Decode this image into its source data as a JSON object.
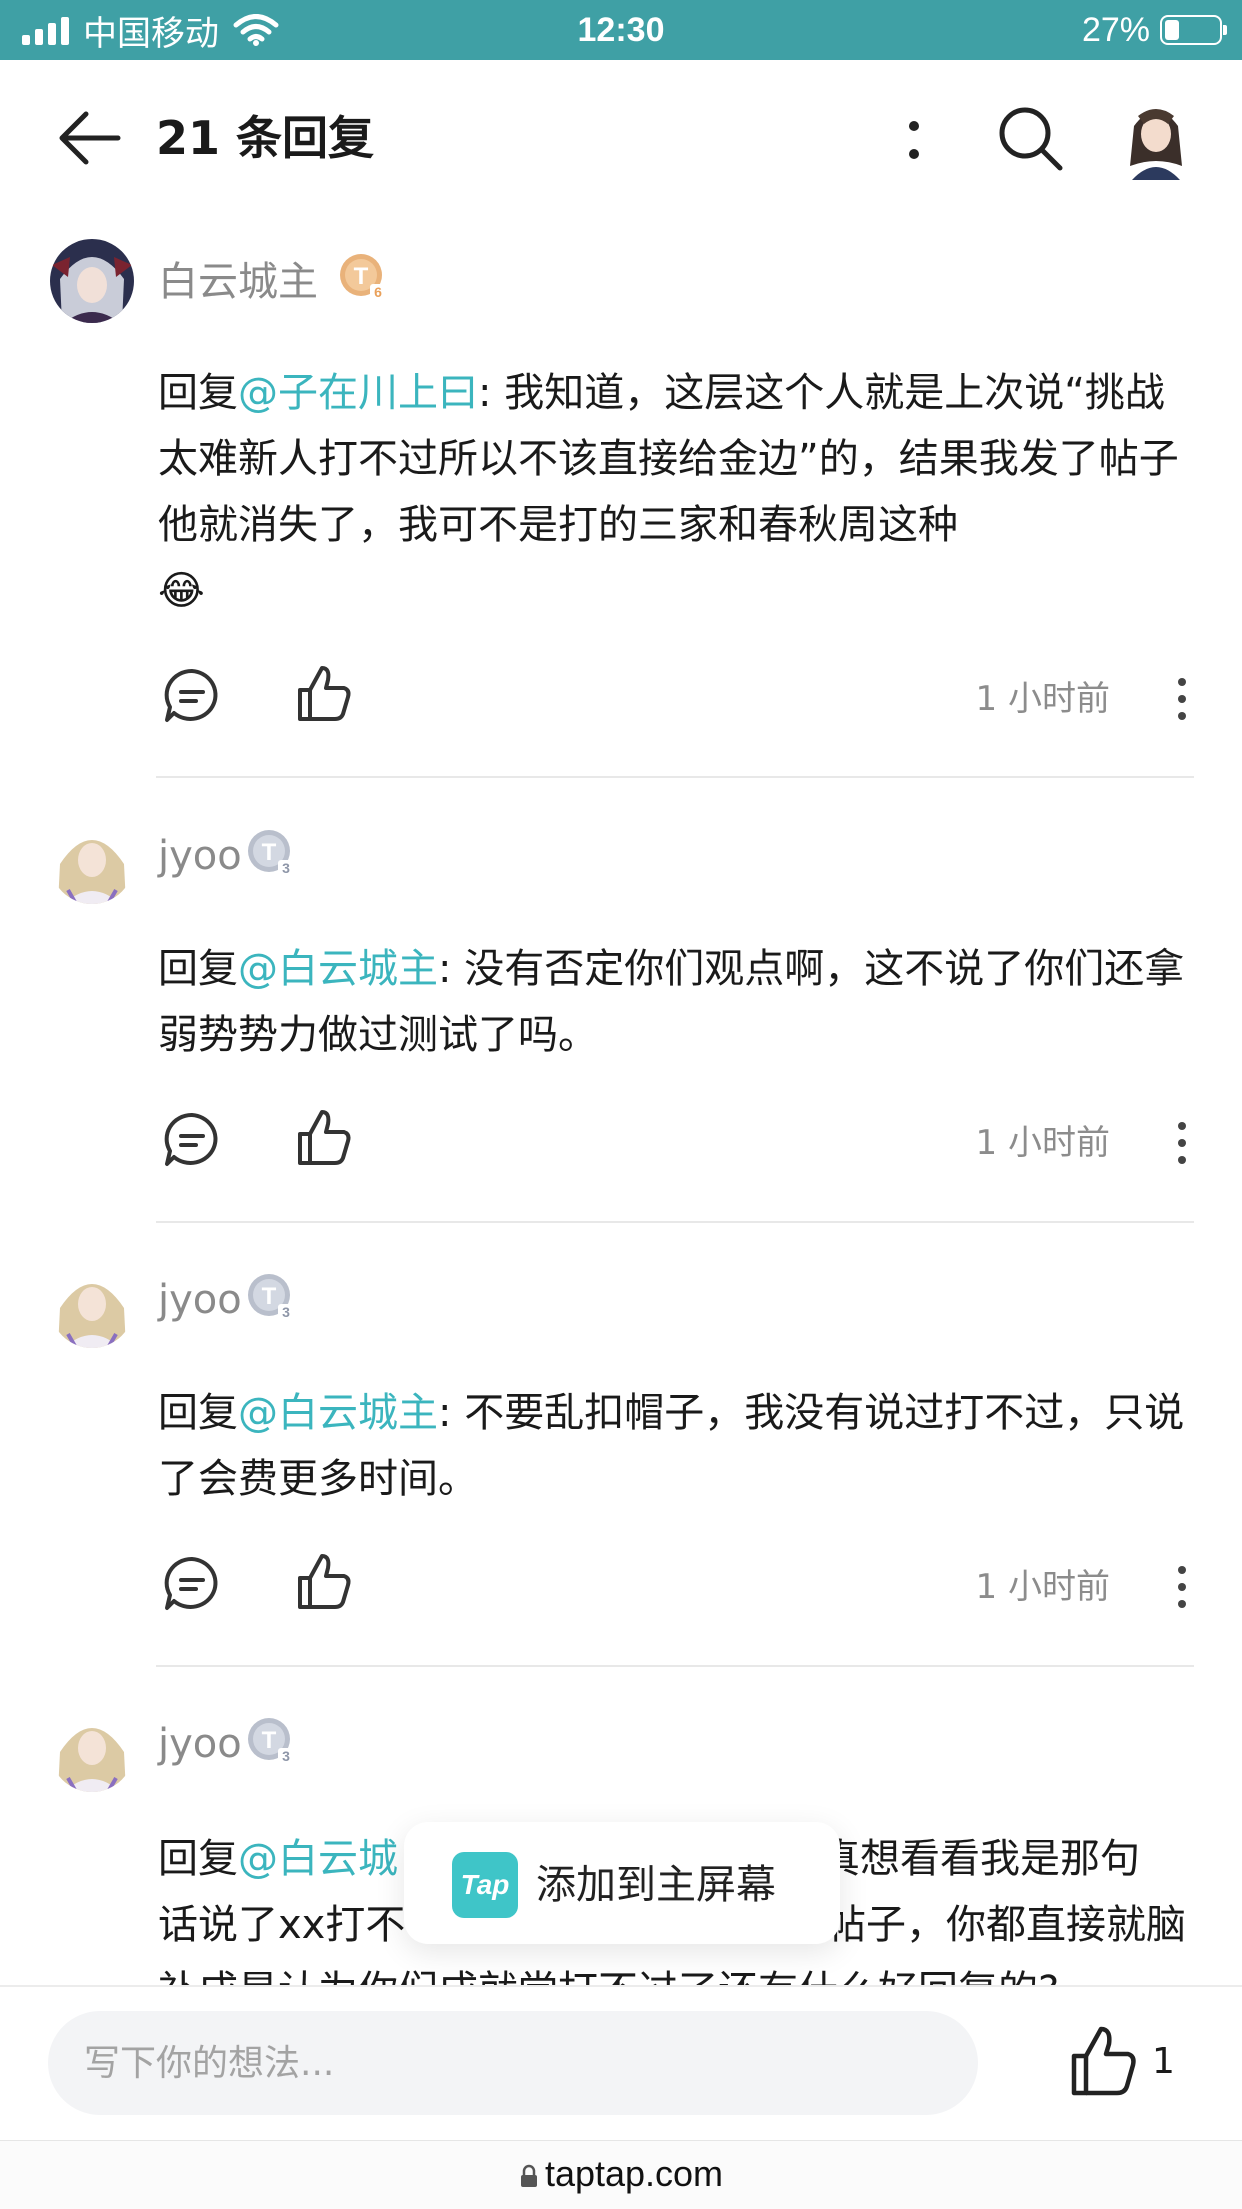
{
  "status_bar": {
    "carrier": "中国移动",
    "time": "12:30",
    "battery": "27%",
    "battery_level": 0.27
  },
  "header": {
    "title": "21 条回复"
  },
  "comments": [
    {
      "username": "白云城主",
      "level": "6",
      "reply_prefix": "回复",
      "mention": "@子在川上曰",
      "text": ": 我知道，这层这个人就是上次说“挑战太难新人打不过所以不该直接给金边”的，结果我发了帖子他就消失了，我可不是打的三家和春秋周这种",
      "emoji": "😂",
      "time": "1 小时前"
    },
    {
      "username": "jyoo",
      "level": "3",
      "reply_prefix": "回复",
      "mention": "@白云城主",
      "text": ": 没有否定你们观点啊，这不说了你们还拿弱势势力做过测试了吗。",
      "time": "1 小时前"
    },
    {
      "username": "jyoo",
      "level": "3",
      "reply_prefix": "回复",
      "mention": "@白云城主",
      "text": ": 不要乱扣帽子，我没有说过打不过，只说了会费更多时间。",
      "time": "1 小时前"
    },
    {
      "username": "jyoo",
      "level": "3",
      "reply_prefix": "回复",
      "mention": "@白云城",
      "line1_tail": "真想看看我是那句",
      "line2_head": "话说了xx打不",
      "line2_tail": "帖子，你都直接就脑",
      "line3": "补成是认为你们成就党打不过了还有什么好回复的?"
    }
  ],
  "toast": {
    "logo_text": "Tap",
    "text": "添加到主屏幕"
  },
  "input": {
    "placeholder": "写下你的想法..."
  },
  "like_count": "1",
  "url": "taptap.com",
  "colors": {
    "status_bar": "#3fa0a5",
    "mention": "#3bb5be",
    "badge_gold": "#e9b27a",
    "badge_silver": "#b9bfcc"
  }
}
